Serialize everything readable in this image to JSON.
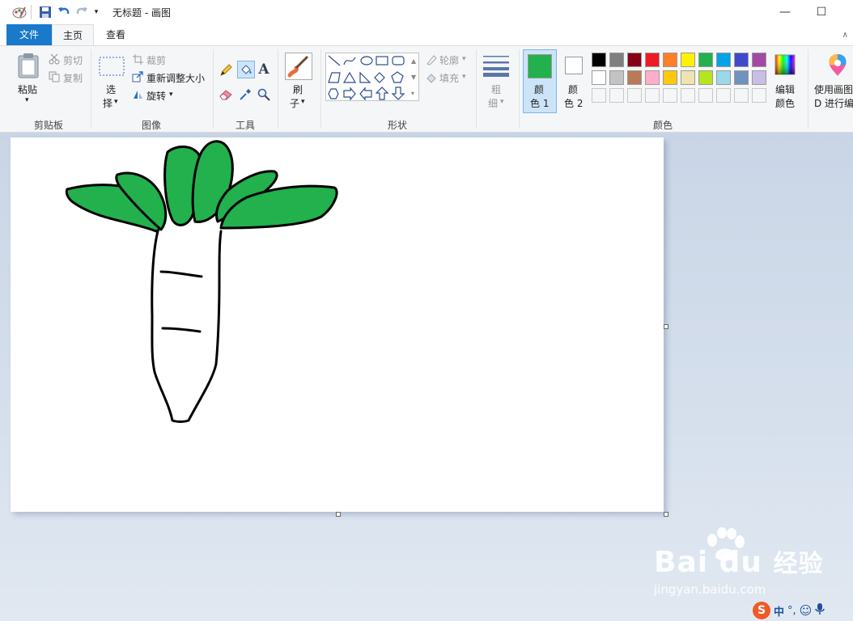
{
  "window": {
    "title": "无标题 - 画图",
    "minimize": "—",
    "maximize": "☐"
  },
  "tabs": {
    "file": "文件",
    "home": "主页",
    "view": "查看"
  },
  "clipboard": {
    "paste": "粘贴",
    "cut": "剪切",
    "copy": "复制",
    "group": "剪贴板"
  },
  "image": {
    "select_1": "选",
    "select_2": "择",
    "crop": "裁剪",
    "resize": "重新调整大小",
    "rotate": "旋转",
    "group": "图像"
  },
  "tools": {
    "group": "工具",
    "text_glyph": "A"
  },
  "brushes": {
    "label_1": "刷",
    "label_2": "子"
  },
  "shapes": {
    "outline": "轮廓",
    "fill": "填充",
    "group": "形状"
  },
  "size": {
    "label_1": "粗",
    "label_2": "细"
  },
  "colors": {
    "color1_1": "颜",
    "color1_2": "色 1",
    "color2_1": "颜",
    "color2_2": "色 2",
    "edit_1": "编辑",
    "edit_2": "颜色",
    "group": "颜色",
    "color1_value": "#22b14c",
    "color2_value": "#ffffff",
    "row1": [
      "#000000",
      "#7f7f7f",
      "#880015",
      "#ed1c24",
      "#ff7f27",
      "#fff200",
      "#22b14c",
      "#00a2e8",
      "#3f48cc",
      "#a349a4"
    ],
    "row2": [
      "#ffffff",
      "#c3c3c3",
      "#b97a57",
      "#ffaec9",
      "#ffc90e",
      "#efe4b0",
      "#b5e61d",
      "#99d9ea",
      "#7092be",
      "#c8bfe7"
    ]
  },
  "paint3d": {
    "label_1": "使用画图",
    "label_2": "D 进行编"
  },
  "ime": {
    "lang": "中",
    "punct": "°,"
  },
  "watermark": {
    "brand": "Bai  du",
    "brand_cn": "经验",
    "url": "jingyan.baidu.com"
  },
  "drawing": {
    "leaf_color": "#22b14c",
    "outline_color": "#000000"
  }
}
